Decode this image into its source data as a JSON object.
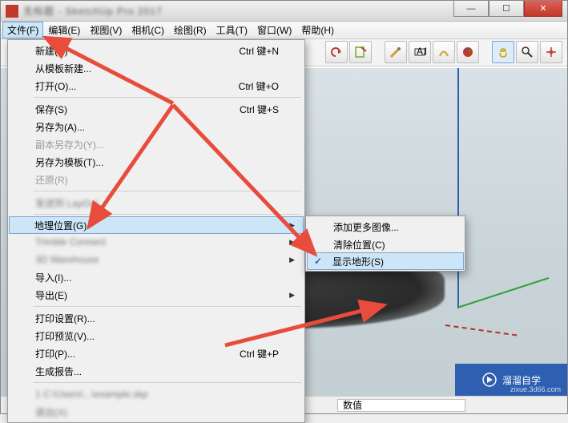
{
  "window": {
    "title": "无标题 - SketchUp Pro 2017"
  },
  "winbtns": {
    "min": "—",
    "max": "☐",
    "close": "✕"
  },
  "menubar": [
    {
      "label": "文件(F)",
      "hot": "F"
    },
    {
      "label": "编辑(E)",
      "hot": "E"
    },
    {
      "label": "视图(V)",
      "hot": "V"
    },
    {
      "label": "相机(C)",
      "hot": "C"
    },
    {
      "label": "绘图(R)",
      "hot": "R"
    },
    {
      "label": "工具(T)",
      "hot": "T"
    },
    {
      "label": "窗口(W)",
      "hot": "W"
    },
    {
      "label": "帮助(H)",
      "hot": "H"
    }
  ],
  "file_menu": {
    "items": [
      {
        "label": "新建(N)",
        "shortcut": "Ctrl 键+N"
      },
      {
        "label": "从模板新建...",
        "shortcut": ""
      },
      {
        "label": "打开(O)...",
        "shortcut": "Ctrl 键+O"
      },
      {
        "sep": true
      },
      {
        "label": "保存(S)",
        "shortcut": "Ctrl 键+S"
      },
      {
        "label": "另存为(A)...",
        "shortcut": ""
      },
      {
        "label": "副本另存为(Y)...",
        "shortcut": "",
        "disabled": true
      },
      {
        "label": "另存为模板(T)...",
        "shortcut": ""
      },
      {
        "label": "还原(R)",
        "shortcut": "",
        "disabled": true
      },
      {
        "sep": true
      },
      {
        "label": "发送到 LayOut",
        "shortcut": "",
        "blur": true
      },
      {
        "sep": true
      },
      {
        "label": "地理位置(G)",
        "shortcut": "",
        "submenu": true,
        "hl": true
      },
      {
        "label": "Trimble Connect",
        "shortcut": "",
        "blur": true,
        "submenu": true
      },
      {
        "label": "3D Warehouse",
        "shortcut": "",
        "blur": true,
        "submenu": true
      },
      {
        "label": "导入(I)...",
        "shortcut": ""
      },
      {
        "label": "导出(E)",
        "shortcut": "",
        "submenu": true
      },
      {
        "sep": true
      },
      {
        "label": "打印设置(R)...",
        "shortcut": ""
      },
      {
        "label": "打印预览(V)...",
        "shortcut": ""
      },
      {
        "label": "打印(P)...",
        "shortcut": "Ctrl 键+P"
      },
      {
        "label": "生成报告...",
        "shortcut": ""
      },
      {
        "sep": true
      },
      {
        "label": "1 C:\\Users\\...\\example.skp",
        "shortcut": "",
        "blur": true
      },
      {
        "label": "退出(X)",
        "shortcut": "",
        "blur": true
      }
    ]
  },
  "submenu": {
    "items": [
      {
        "label": "添加更多图像..."
      },
      {
        "label": "清除位置(C)"
      },
      {
        "label": "显示地形(S)",
        "checked": true,
        "hl": true
      }
    ]
  },
  "statusbar": {
    "value_label": "数值"
  },
  "watermark": {
    "brand": "溜溜自学",
    "domain": "zixue.3d66.com"
  },
  "icons": {
    "orbit": "orbit",
    "pan": "pan",
    "zoom": "zoom",
    "zoomext": "zoom-extents",
    "undo": "undo",
    "redo": "redo",
    "tape": "tape",
    "text": "text",
    "paint": "paint"
  }
}
